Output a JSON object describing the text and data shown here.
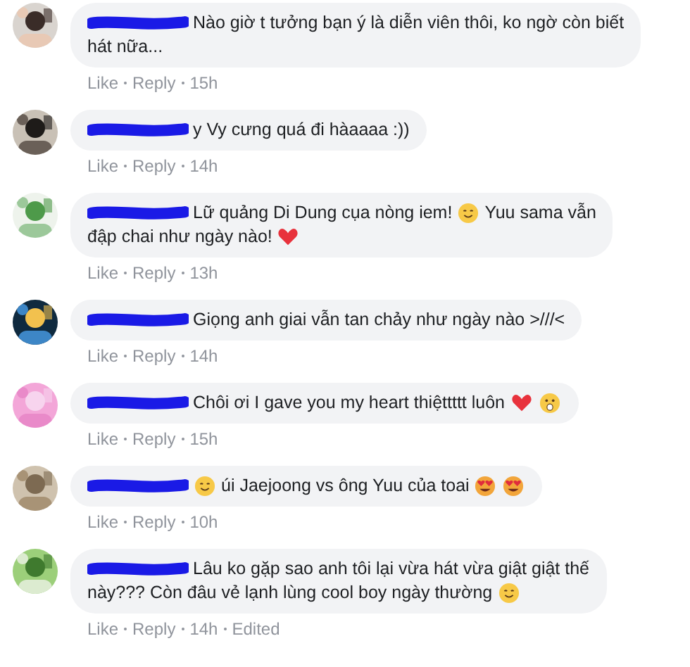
{
  "comments": [
    {
      "name_redacted": true,
      "lines": [
        [
          {
            "kind": "text",
            "text": "Nào giờ t tưởng bạn ý là diễn viên thôi, ko ngờ còn biết"
          }
        ],
        [
          {
            "kind": "text",
            "text": "hát nữa..."
          }
        ]
      ],
      "actions": [
        "Like",
        "Reply"
      ],
      "time": "15h"
    },
    {
      "name_redacted": true,
      "lines": [
        [
          {
            "kind": "text",
            "text": "y Vy cưng quá đi hàaaaa :))"
          }
        ]
      ],
      "actions": [
        "Like",
        "Reply"
      ],
      "time": "14h"
    },
    {
      "name_redacted": true,
      "lines": [
        [
          {
            "kind": "text",
            "text": "Lữ quảng Di Dung cụa nòng iem!"
          },
          {
            "kind": "smiley"
          },
          {
            "kind": "text",
            "text": "Yuu sama vẫn"
          }
        ],
        [
          {
            "kind": "text",
            "text": "đập chai như ngày nào!"
          },
          {
            "kind": "heart"
          }
        ]
      ],
      "actions": [
        "Like",
        "Reply"
      ],
      "time": "13h"
    },
    {
      "name_redacted": true,
      "lines": [
        [
          {
            "kind": "text",
            "text": "Giọng anh giai vẫn tan chảy như ngày nào >///<"
          }
        ]
      ],
      "actions": [
        "Like",
        "Reply"
      ],
      "time": "14h"
    },
    {
      "name_redacted": true,
      "lines": [
        [
          {
            "kind": "text",
            "text": "Chôi ơi I gave you my heart thiệttttt luôn"
          },
          {
            "kind": "heart"
          },
          {
            "kind": "gasp"
          }
        ]
      ],
      "actions": [
        "Like",
        "Reply"
      ],
      "time": "15h"
    },
    {
      "name_redacted": true,
      "lines": [
        [
          {
            "kind": "smiley"
          },
          {
            "kind": "text",
            "text": "úi Jaejoong vs ông Yuu của toai"
          },
          {
            "kind": "hearteyes"
          },
          {
            "kind": "hearteyes"
          }
        ]
      ],
      "actions": [
        "Like",
        "Reply"
      ],
      "time": "10h"
    },
    {
      "name_redacted": true,
      "lines": [
        [
          {
            "kind": "text",
            "text": "Lâu ko gặp sao anh tôi lại vừa hát vừa giật giật thế"
          }
        ],
        [
          {
            "kind": "text",
            "text": "này??? Còn đâu vẻ lạnh lùng cool boy ngày thường"
          },
          {
            "kind": "smiley"
          }
        ]
      ],
      "actions": [
        "Like",
        "Reply"
      ],
      "time": "14h",
      "note": "Edited"
    }
  ]
}
